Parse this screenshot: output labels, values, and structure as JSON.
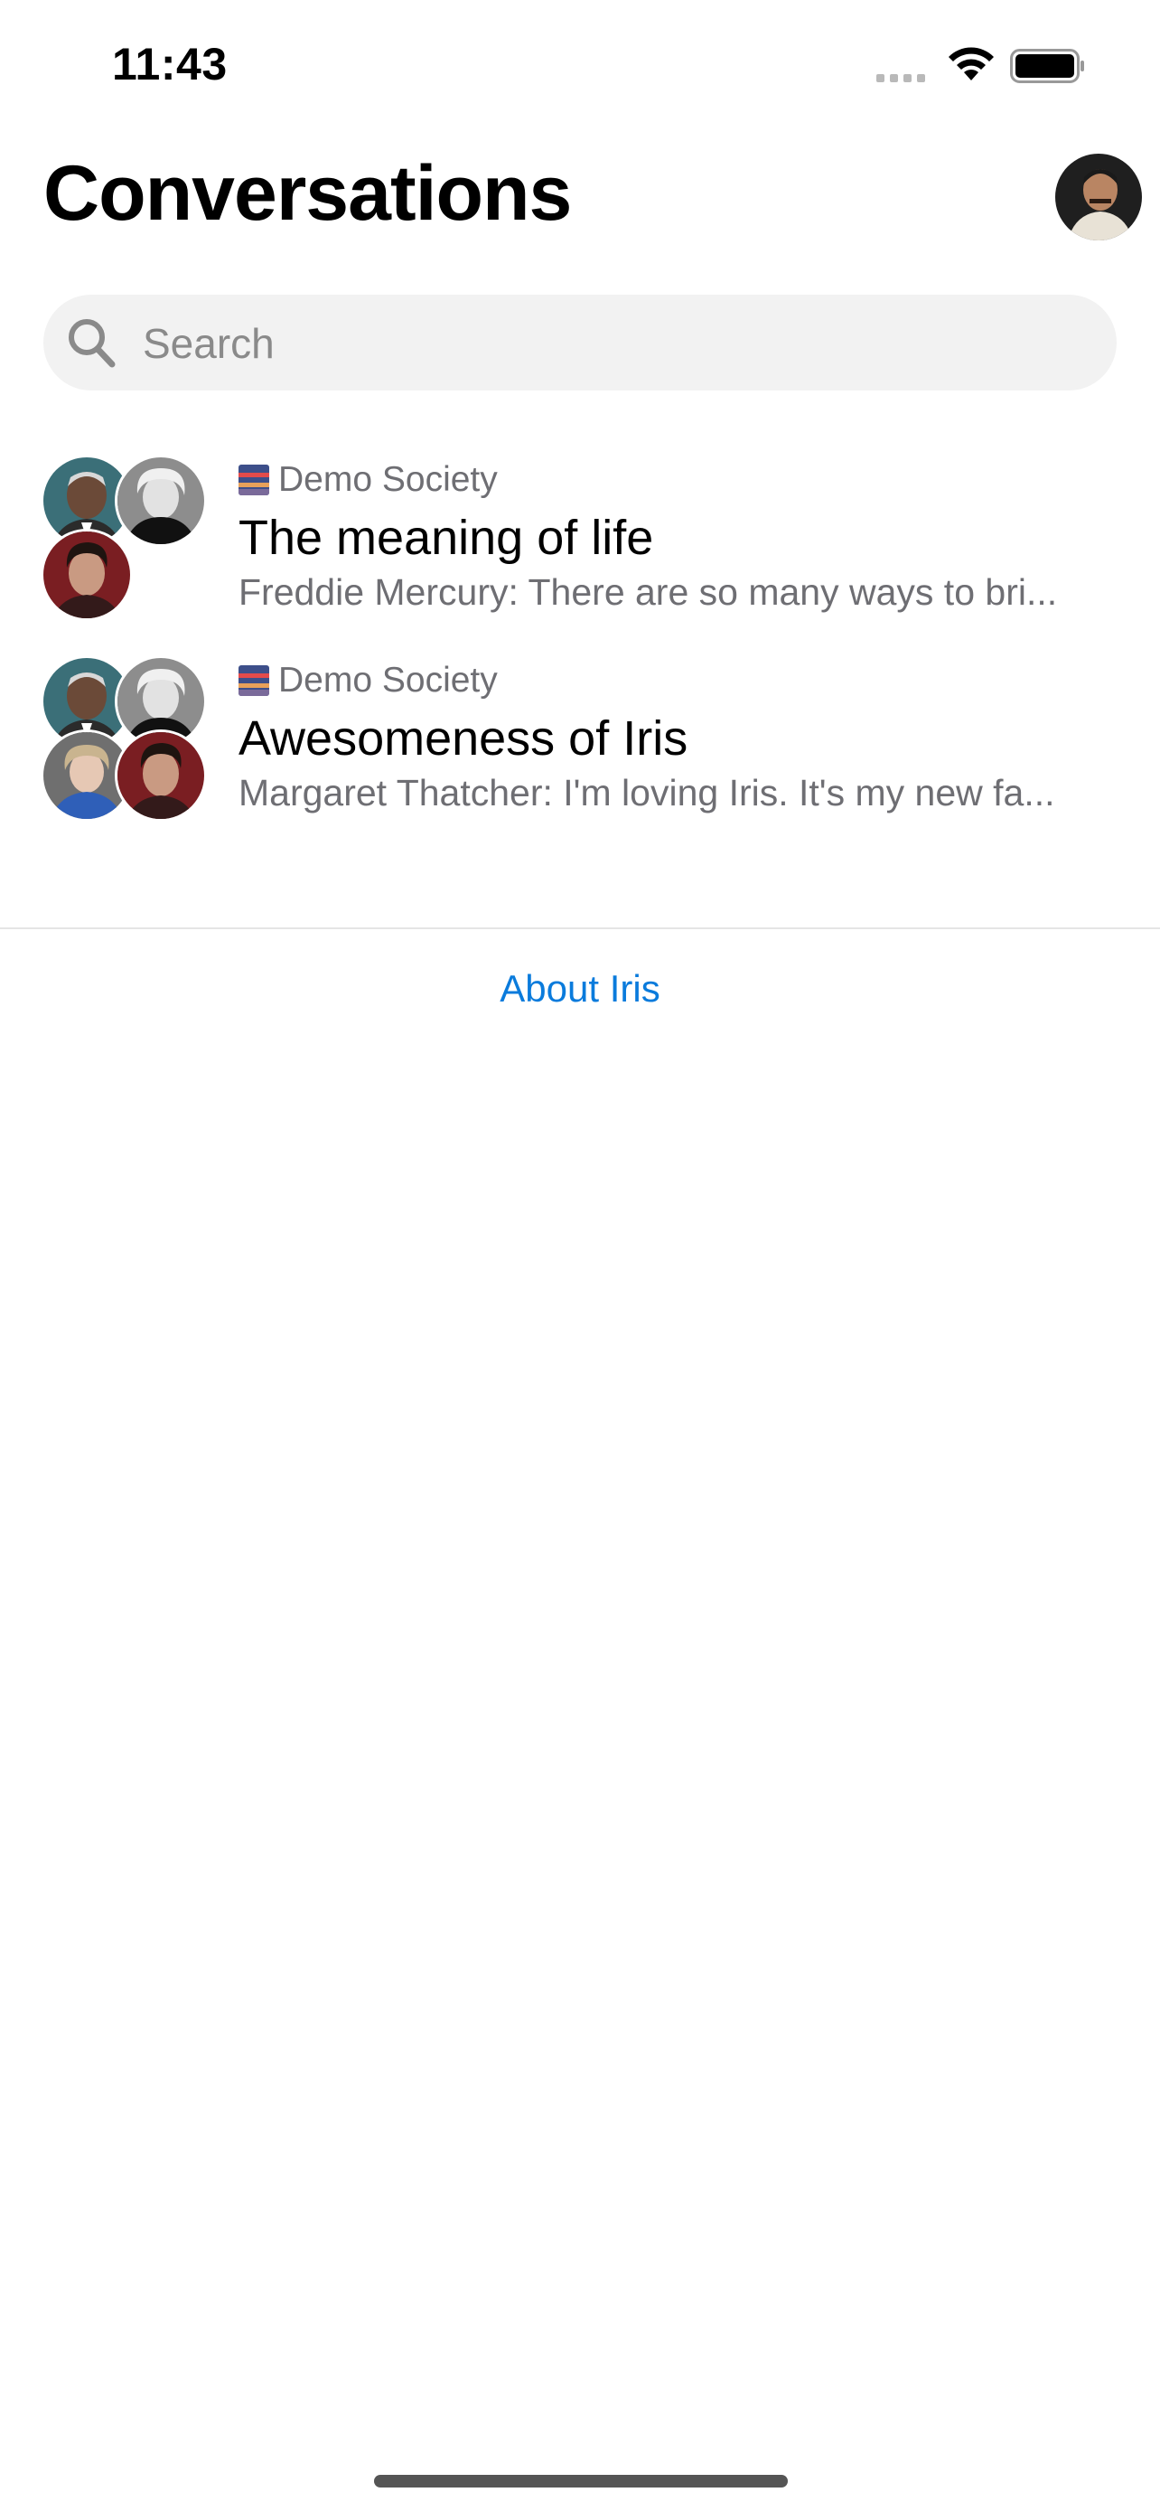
{
  "status_bar": {
    "time": "11:43"
  },
  "header": {
    "title": "Conversations"
  },
  "search": {
    "placeholder": "Search"
  },
  "conversations": [
    {
      "group": "Demo Society",
      "title": "The meaning of life",
      "preview": "Freddie Mercury: There are so many ways to bri..."
    },
    {
      "group": "Demo Society",
      "title": "Awesomeness of Iris",
      "preview": "Margaret Thatcher: I'm loving Iris. It's my new fa..."
    }
  ],
  "footer": {
    "about_link": "About Iris"
  },
  "colors": {
    "link": "#0a7bdc",
    "secondary_text": "#6e6e73",
    "search_bg": "#f2f2f2"
  }
}
